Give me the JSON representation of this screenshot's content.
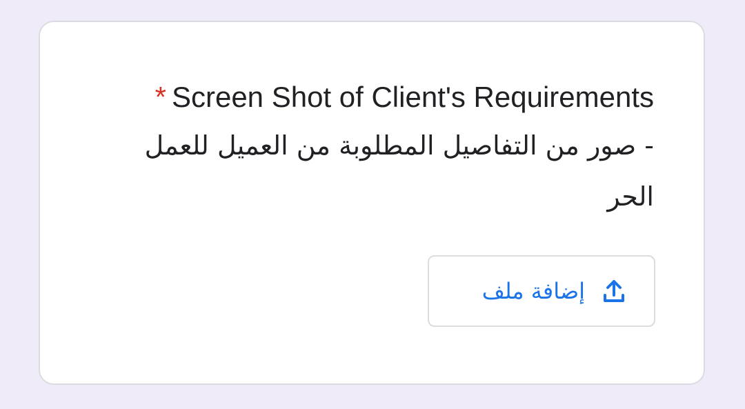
{
  "question": {
    "required_marker": "*",
    "title": "Screen Shot of Client's Requirements",
    "subtitle": "- صور من التفاصيل المطلوبة من العميل للعمل الحر"
  },
  "upload": {
    "button_label": "إضافة ملف",
    "icon": "upload-icon"
  },
  "colors": {
    "page_background": "#f0ebf8",
    "required": "#d93025",
    "accent": "#1a73e8",
    "border": "#dadce0"
  }
}
